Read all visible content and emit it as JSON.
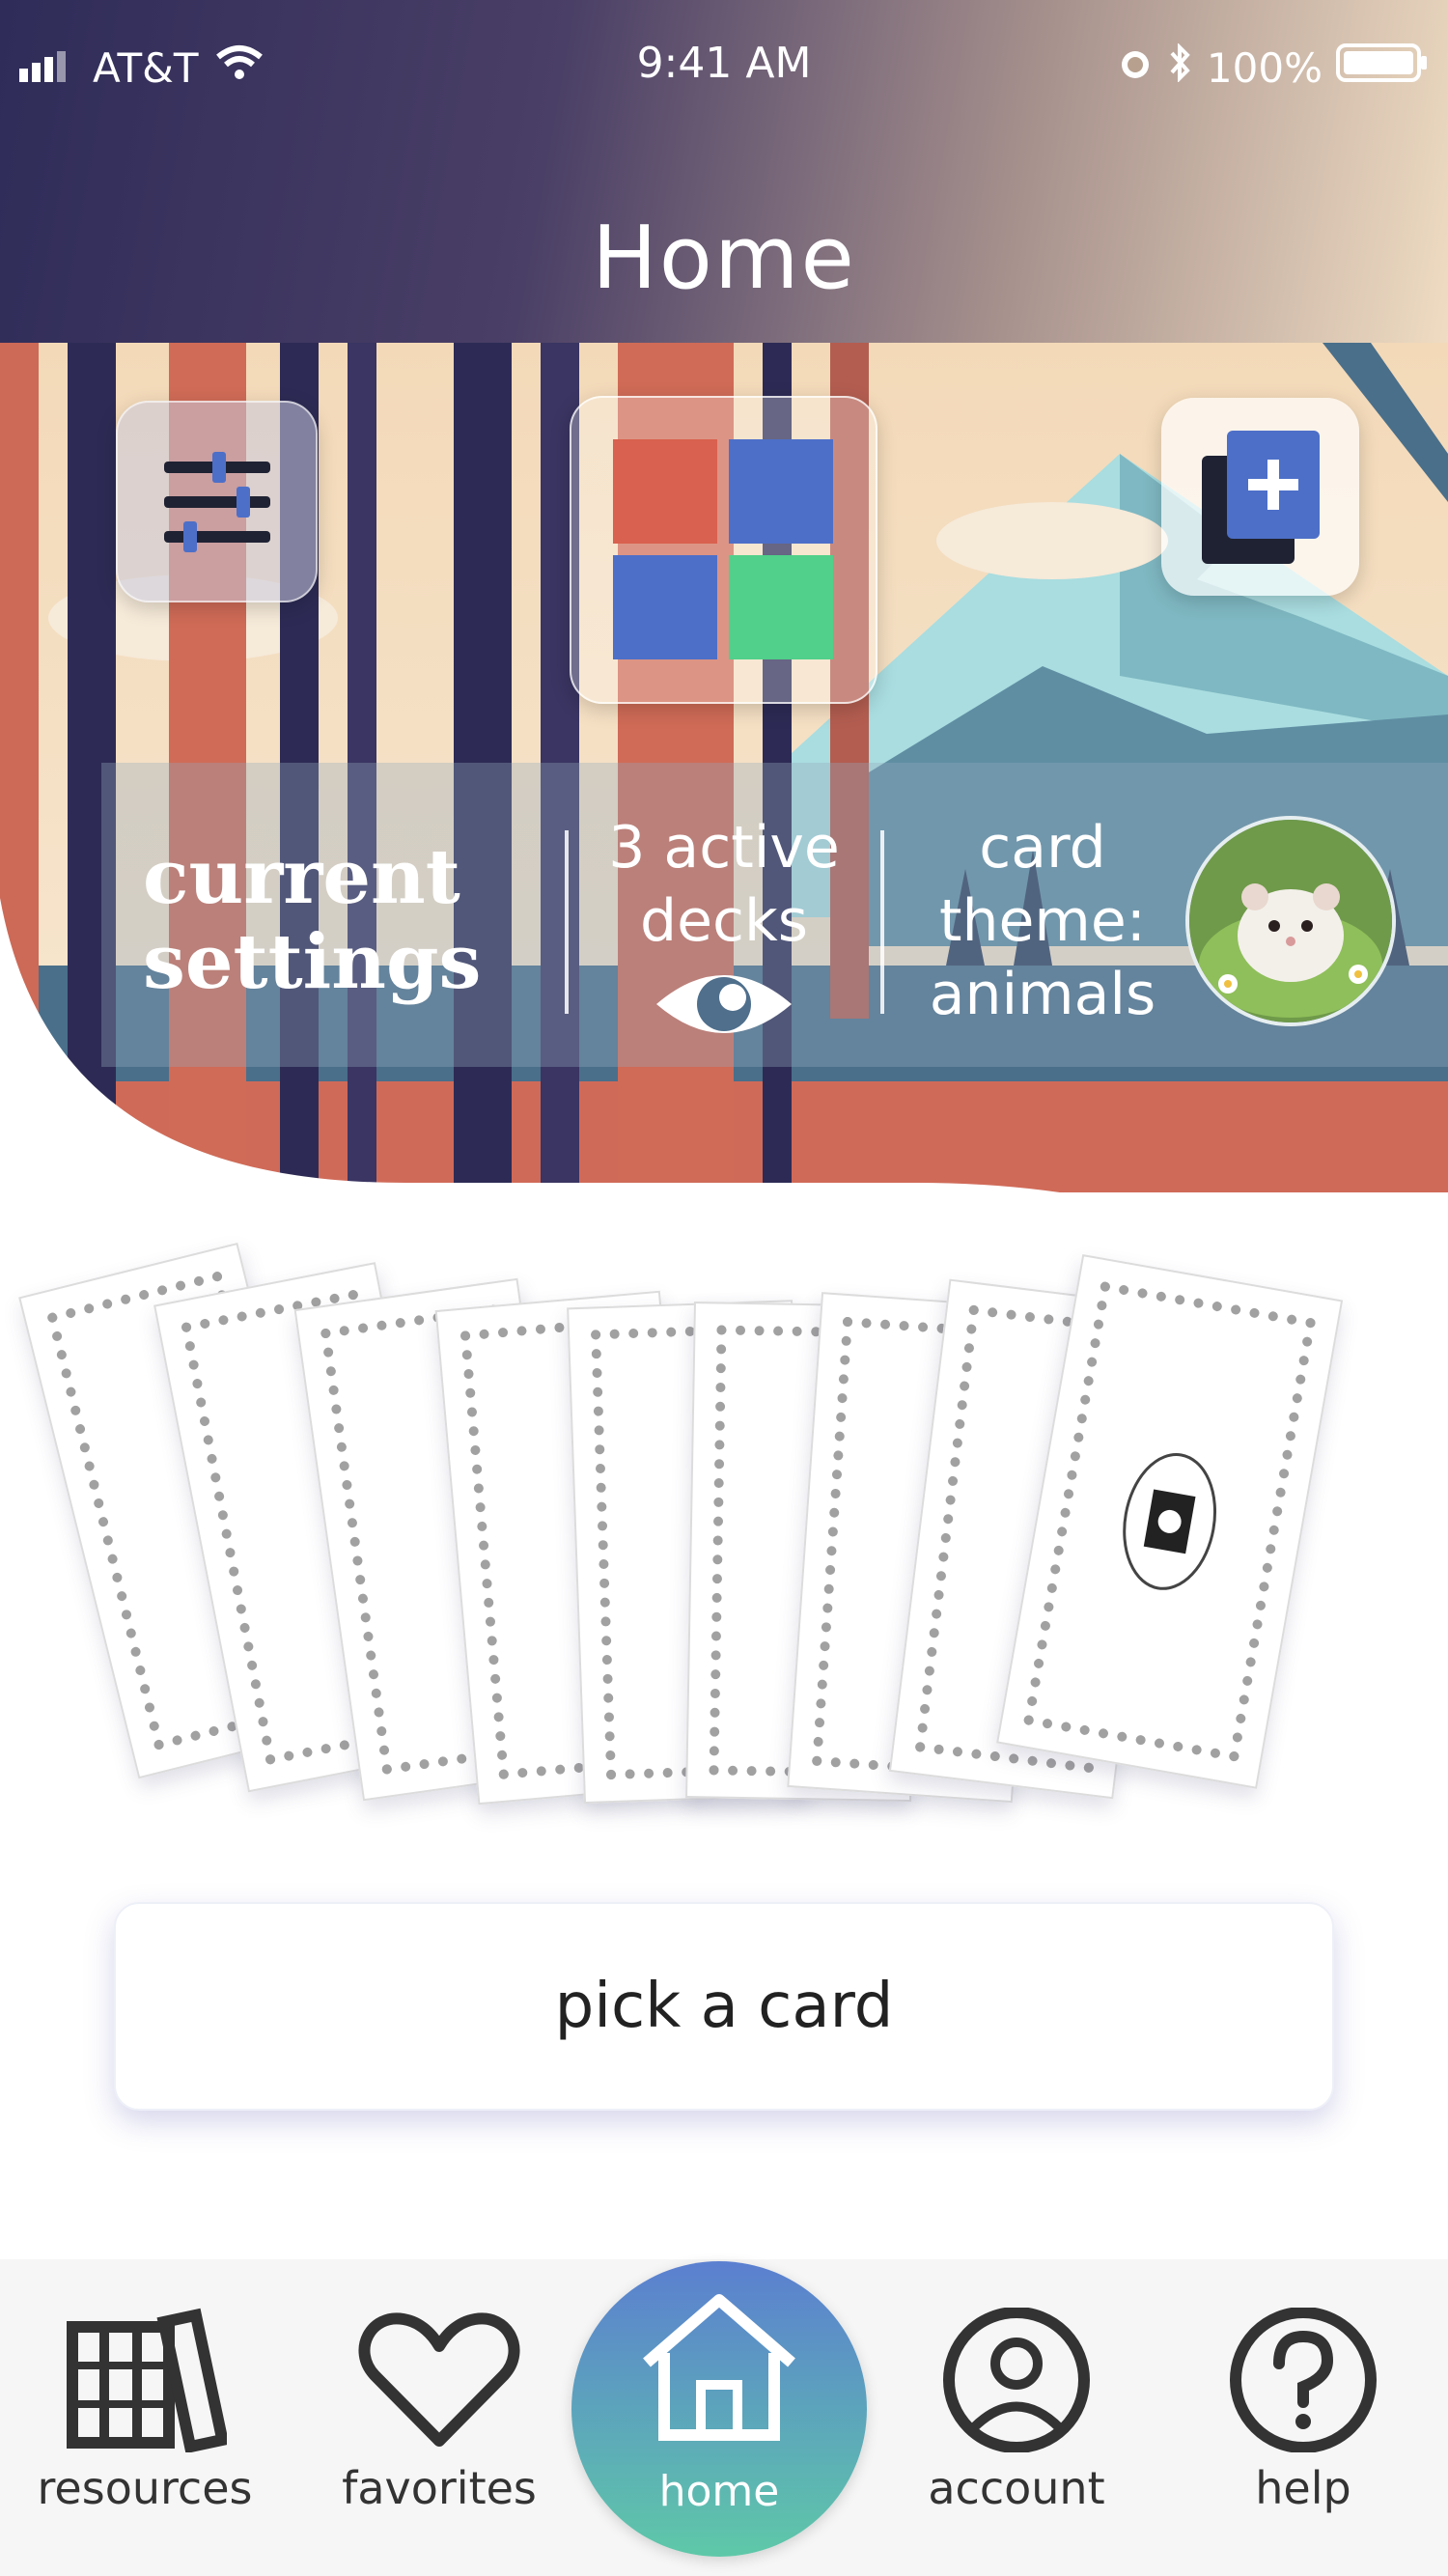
{
  "status_bar": {
    "carrier": "AT&T",
    "time": "9:41 AM",
    "battery": "100%"
  },
  "header": {
    "title": "Home"
  },
  "controls": {
    "filter_icon": "sliders-icon",
    "decks_icon": "four-color-grid-icon",
    "add_icon": "add-deck-icon"
  },
  "settings": {
    "title_line1": "current",
    "title_line2": "settings",
    "decks_line1": "3 active",
    "decks_line2": "decks",
    "theme_line1": "card",
    "theme_line2": "theme:",
    "theme_line3": "animals"
  },
  "actions": {
    "pick_label": "pick a card"
  },
  "nav": {
    "items": [
      {
        "label": "resources",
        "icon": "books-icon"
      },
      {
        "label": "favorites",
        "icon": "heart-icon"
      },
      {
        "label": "home",
        "icon": "house-icon"
      },
      {
        "label": "account",
        "icon": "user-icon"
      },
      {
        "label": "help",
        "icon": "help-icon"
      }
    ]
  },
  "colors": {
    "deck_red": "#d9614f",
    "deck_blue": "#4d6fc8",
    "deck_green": "#50d08a",
    "nav_home_top": "#5b7fd0",
    "nav_home_bottom": "#5ec8a8"
  }
}
